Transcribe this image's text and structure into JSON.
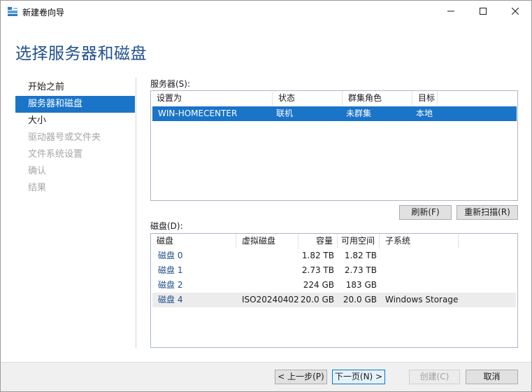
{
  "window": {
    "title": "新建卷向导"
  },
  "header": {
    "title": "选择服务器和磁盘"
  },
  "nav": {
    "items": [
      {
        "label": "开始之前",
        "state": "normal"
      },
      {
        "label": "服务器和磁盘",
        "state": "active"
      },
      {
        "label": "大小",
        "state": "normal"
      },
      {
        "label": "驱动器号或文件夹",
        "state": "disabled"
      },
      {
        "label": "文件系统设置",
        "state": "disabled"
      },
      {
        "label": "确认",
        "state": "disabled"
      },
      {
        "label": "结果",
        "state": "disabled"
      }
    ]
  },
  "servers": {
    "label": "服务器(S):",
    "columns": [
      "设置为",
      "状态",
      "群集角色",
      "目标"
    ],
    "rows": [
      {
        "name": "WIN-HOMECENTER",
        "status": "联机",
        "role": "未群集",
        "target": "本地"
      }
    ],
    "refresh_label": "刷新(F)",
    "rescan_label": "重新扫描(R)"
  },
  "disks": {
    "label": "磁盘(D):",
    "columns": [
      "磁盘",
      "虚拟磁盘",
      "容量",
      "可用空间",
      "子系统"
    ],
    "rows": [
      {
        "disk": "磁盘 0",
        "vdisk": "",
        "capacity": "1.82 TB",
        "free": "1.82 TB",
        "subsystem": ""
      },
      {
        "disk": "磁盘 1",
        "vdisk": "",
        "capacity": "2.73 TB",
        "free": "2.73 TB",
        "subsystem": ""
      },
      {
        "disk": "磁盘 2",
        "vdisk": "",
        "capacity": "224 GB",
        "free": "183 GB",
        "subsystem": ""
      },
      {
        "disk": "磁盘 4",
        "vdisk": "ISO20240402",
        "capacity": "20.0 GB",
        "free": "20.0 GB",
        "subsystem": "Windows Storage"
      }
    ]
  },
  "footer": {
    "prev_label": "< 上一步(P)",
    "next_label": "下一页(N) >",
    "create_label": "创建(C)",
    "cancel_label": "取消"
  },
  "colors": {
    "accent": "#1a74c8",
    "title_blue": "#1e4e8c"
  }
}
